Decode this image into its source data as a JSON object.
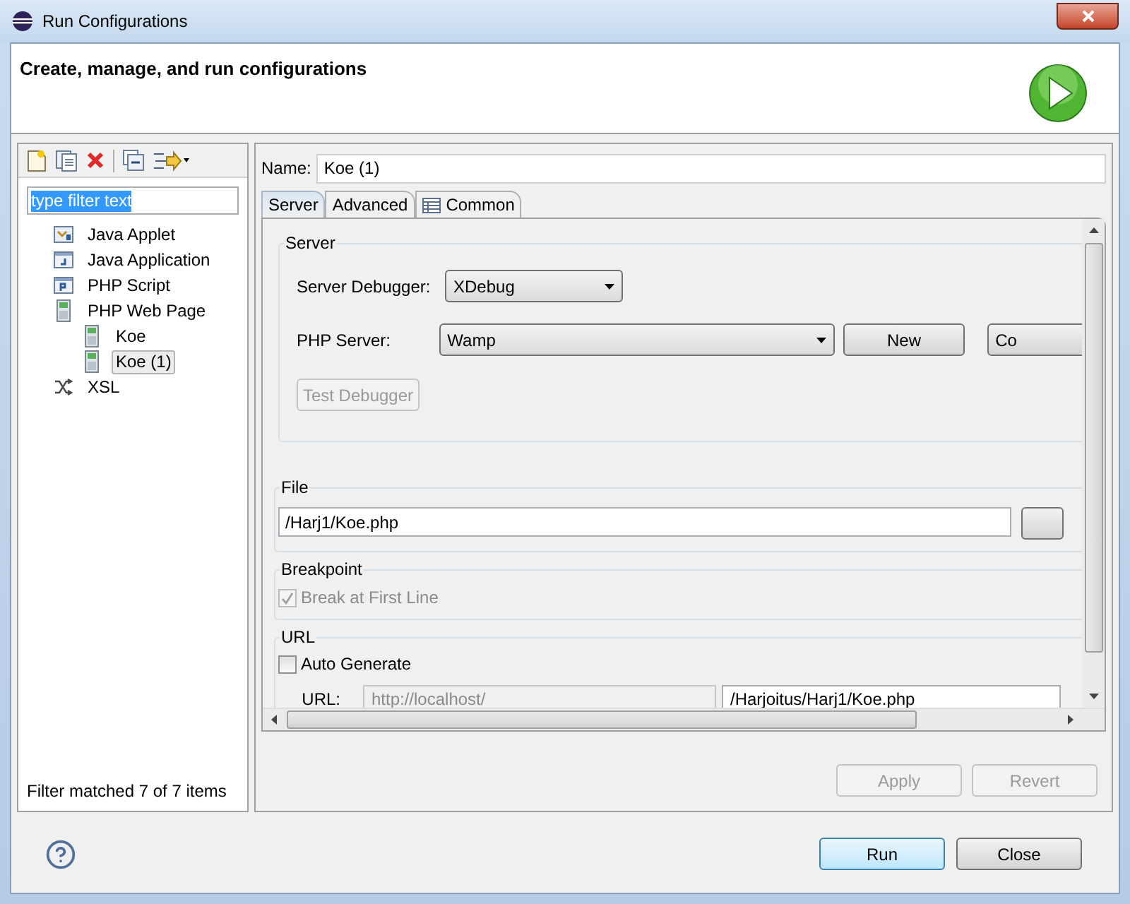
{
  "window": {
    "title": "Run Configurations"
  },
  "header": {
    "title": "Create, manage, and run configurations"
  },
  "filter": {
    "value": "type filter text",
    "selected": true
  },
  "tree": [
    {
      "label": "Java Applet",
      "kind": "applet",
      "selected": false
    },
    {
      "label": "Java Application",
      "kind": "java",
      "selected": false
    },
    {
      "label": "PHP Script",
      "kind": "php",
      "selected": false
    },
    {
      "label": "PHP Web Page",
      "kind": "web",
      "selected": false,
      "children": [
        {
          "label": "Koe",
          "kind": "web",
          "selected": false
        },
        {
          "label": "Koe (1)",
          "kind": "web",
          "selected": true
        }
      ]
    },
    {
      "label": "XSL",
      "kind": "xsl",
      "selected": false
    }
  ],
  "filter_status": "Filter matched 7 of 7 items",
  "name": {
    "label": "Name:",
    "value": "Koe (1)"
  },
  "tabs": [
    {
      "label": "Server",
      "selected": true,
      "has_icon": false
    },
    {
      "label": "Advanced",
      "selected": false,
      "has_icon": false
    },
    {
      "label": "Common",
      "selected": false,
      "has_icon": true
    }
  ],
  "server_group": {
    "title": "Server",
    "debugger": {
      "label": "Server Debugger:",
      "value": "XDebug"
    },
    "php_server": {
      "label": "PHP Server:",
      "value": "Wamp"
    },
    "buttons": [
      {
        "label": "New"
      },
      {
        "label": "Co"
      }
    ],
    "test_button": {
      "label": "Test Debugger",
      "disabled": true
    }
  },
  "file_group": {
    "title": "File",
    "value": "/Harj1/Koe.php"
  },
  "breakpoint_group": {
    "title": "Breakpoint",
    "checkbox": {
      "label": "Break at First Line",
      "checked": true,
      "disabled": true
    }
  },
  "url_group": {
    "title": "URL",
    "auto": {
      "label": "Auto Generate",
      "checked": false
    },
    "url_label": "URL:",
    "base": {
      "value": "http://localhost/",
      "disabled": true
    },
    "path": "/Harjoitus/Harj1/Koe.php"
  },
  "actions": [
    {
      "label": "Apply",
      "disabled": true
    },
    {
      "label": "Revert",
      "disabled": true
    }
  ],
  "footer_buttons": [
    {
      "label": "Run",
      "default": true
    },
    {
      "label": "Close",
      "default": false
    }
  ]
}
